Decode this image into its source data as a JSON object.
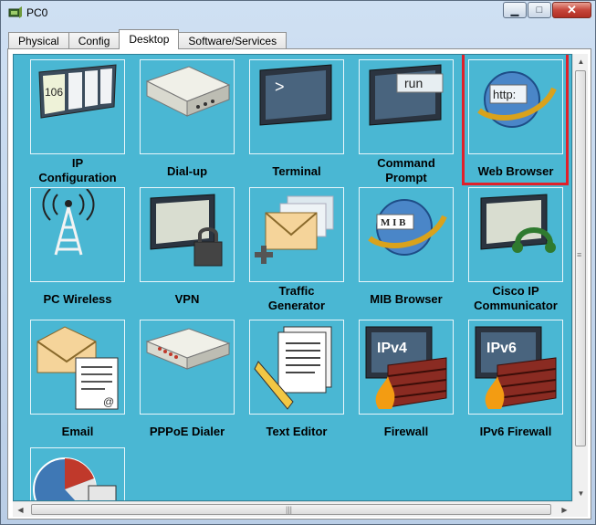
{
  "window": {
    "title": "PC0",
    "icon": "router-pc-icon",
    "controls": {
      "minimize": "▁",
      "maximize": "□",
      "close": "✕"
    }
  },
  "tabs": [
    {
      "label": "Physical",
      "active": false
    },
    {
      "label": "Config",
      "active": false
    },
    {
      "label": "Desktop",
      "active": true
    },
    {
      "label": "Software/Services",
      "active": false
    }
  ],
  "desktop": {
    "background": "#4ab7d3",
    "highlight_color": "#e0202a",
    "highlighted_item": "Web Browser",
    "items": [
      {
        "label": "IP Configuration",
        "line1": "IP",
        "line2": "Configuration",
        "icon": "ip-config-icon",
        "badge": "106"
      },
      {
        "label": "Dial-up",
        "line1": "Dial-up",
        "line2": "",
        "icon": "dialup-modem-icon"
      },
      {
        "label": "Terminal",
        "line1": "Terminal",
        "line2": "",
        "icon": "terminal-icon",
        "badge": ">"
      },
      {
        "label": "Command Prompt",
        "line1": "Command",
        "line2": "Prompt",
        "icon": "command-prompt-icon",
        "badge": "run"
      },
      {
        "label": "Web Browser",
        "line1": "Web Browser",
        "line2": "",
        "icon": "web-browser-icon",
        "badge": "http:"
      },
      {
        "label": "PC Wireless",
        "line1": "PC Wireless",
        "line2": "",
        "icon": "wireless-tower-icon"
      },
      {
        "label": "VPN",
        "line1": "VPN",
        "line2": "",
        "icon": "vpn-lock-icon"
      },
      {
        "label": "Traffic Generator",
        "line1": "Traffic",
        "line2": "Generator",
        "icon": "traffic-generator-icon"
      },
      {
        "label": "MIB Browser",
        "line1": "MIB Browser",
        "line2": "",
        "icon": "mib-browser-icon",
        "badge": "M I B"
      },
      {
        "label": "Cisco IP Communicator",
        "line1": "Cisco IP",
        "line2": "Communicator",
        "icon": "ip-communicator-icon"
      },
      {
        "label": "Email",
        "line1": "Email",
        "line2": "",
        "icon": "email-icon",
        "badge": "@"
      },
      {
        "label": "PPPoE Dialer",
        "line1": "PPPoE Dialer",
        "line2": "",
        "icon": "pppoe-dialer-icon"
      },
      {
        "label": "Text Editor",
        "line1": "Text Editor",
        "line2": "",
        "icon": "text-editor-icon"
      },
      {
        "label": "Firewall",
        "line1": "Firewall",
        "line2": "",
        "icon": "firewall-icon",
        "badge": "IPv4"
      },
      {
        "label": "IPv6 Firewall",
        "line1": "IPv6 Firewall",
        "line2": "",
        "icon": "ipv6-firewall-icon",
        "badge": "IPv6"
      },
      {
        "label": "",
        "line1": "",
        "line2": "",
        "icon": "pie-chart-icon"
      }
    ]
  },
  "scrollbars": {
    "up": "▲",
    "down": "▼",
    "left": "◀",
    "right": "▶",
    "grip_v": "≡",
    "grip_h": "|||"
  }
}
